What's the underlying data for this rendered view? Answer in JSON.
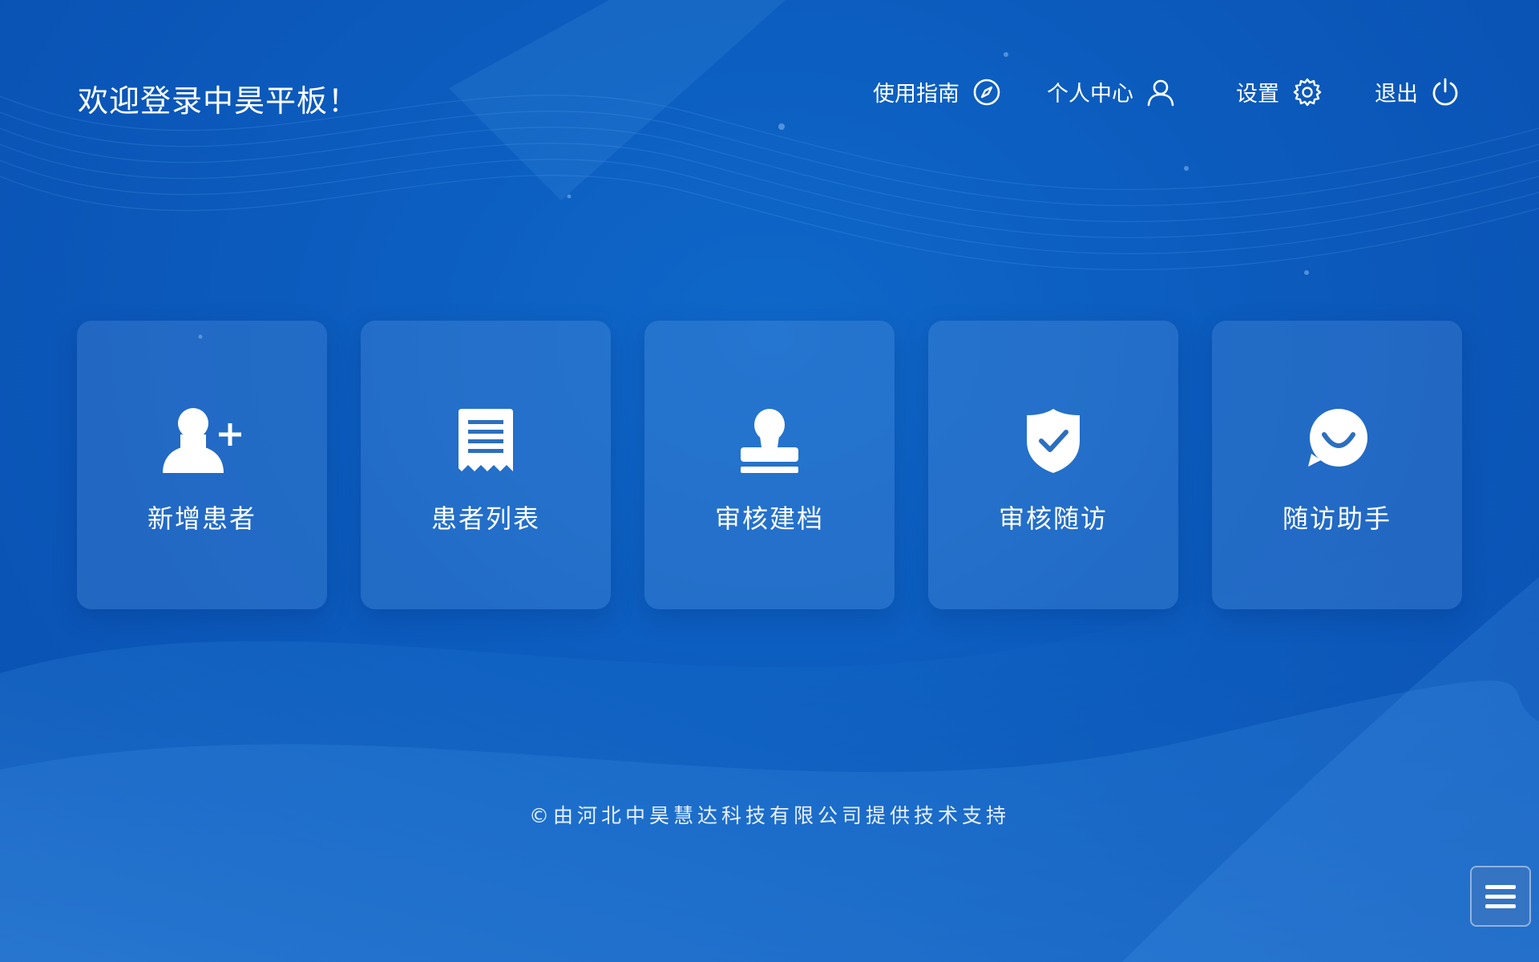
{
  "header": {
    "welcome": "欢迎登录中昊平板！",
    "nav": [
      {
        "label": "使用指南",
        "icon": "compass-icon"
      },
      {
        "label": "个人中心",
        "icon": "user-icon"
      },
      {
        "label": "设置",
        "icon": "gear-icon"
      },
      {
        "label": "退出",
        "icon": "power-icon"
      }
    ]
  },
  "cards": [
    {
      "label": "新增患者",
      "icon": "add-user-icon"
    },
    {
      "label": "患者列表",
      "icon": "receipt-list-icon"
    },
    {
      "label": "审核建档",
      "icon": "stamp-icon"
    },
    {
      "label": "审核随访",
      "icon": "shield-check-icon"
    },
    {
      "label": "随访助手",
      "icon": "smile-chat-icon"
    }
  ],
  "footer": {
    "text": "©由河北中昊慧达科技有限公司提供技术支持"
  },
  "menu_button": {
    "icon": "menu-icon"
  },
  "colors": {
    "background": "#0b5bbd",
    "card": "#3b82cf",
    "text": "#ffffff"
  }
}
